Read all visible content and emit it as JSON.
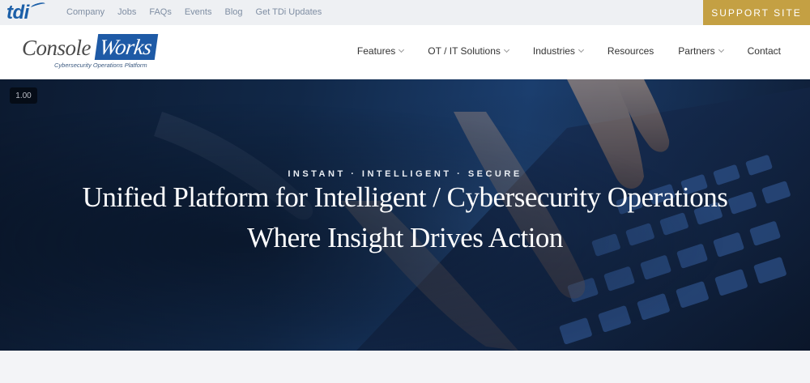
{
  "topbar": {
    "logo": "tdi",
    "links": [
      "Company",
      "Jobs",
      "FAQs",
      "Events",
      "Blog",
      "Get TDi Updates"
    ],
    "support_label": "SUPPORT SITE"
  },
  "brand": {
    "console": "Console",
    "works": "Works",
    "tagline": "Cybersecurity  Operations Platform"
  },
  "nav": {
    "items": [
      {
        "label": "Features",
        "dropdown": true
      },
      {
        "label": "OT / IT Solutions",
        "dropdown": true
      },
      {
        "label": "Industries",
        "dropdown": true
      },
      {
        "label": "Resources",
        "dropdown": false
      },
      {
        "label": "Partners",
        "dropdown": true
      },
      {
        "label": "Contact",
        "dropdown": false
      }
    ]
  },
  "hero": {
    "speed": "1.00",
    "eyebrow": "INSTANT · INTELLIGENT · SECURE",
    "headline_line1": "Unified Platform for Intelligent / Cybersecurity Operations",
    "headline_line2": "Where Insight Drives Action"
  },
  "colors": {
    "accent_gold": "#c4a043",
    "brand_blue": "#1e5aa6",
    "hero_dark": "#0c1a30"
  }
}
